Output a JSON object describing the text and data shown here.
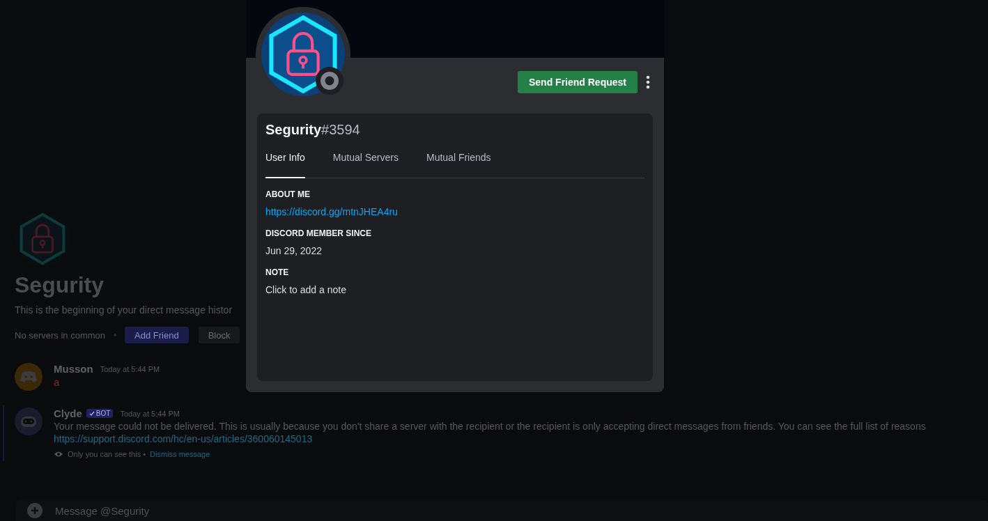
{
  "dm_header": {
    "name": "Segurity",
    "intro": "This is the beginning of your direct message histor",
    "mutual": "No servers in common",
    "buttons": [
      {
        "label": "Add Friend",
        "kind": "primary"
      },
      {
        "label": "Block",
        "kind": "secondary"
      }
    ]
  },
  "messages": [
    {
      "author": "Musson",
      "kind": "user",
      "time": "Today at 5:44 PM",
      "text": "a"
    },
    {
      "author": "Clyde",
      "kind": "bot",
      "badge": "BOT",
      "time": "Today at 5:44 PM",
      "text": "Your message could not be delivered. This is usually because you don't share a server with the recipient or the recipient is only accepting direct messages from friends. You can see the full list of reasons",
      "link": "https://support.discord.com/hc/en-us/articles/360060145013",
      "note": "Only you can see this •",
      "dismiss": "Dismiss message"
    }
  ],
  "composer": {
    "placeholder": "Message @Segurity"
  },
  "profile": {
    "username": "Segurity",
    "discriminator": "#3594",
    "action": "Send Friend Request",
    "tabs": [
      {
        "label": "User Info",
        "selected": true
      },
      {
        "label": "Mutual Servers",
        "selected": false
      },
      {
        "label": "Mutual Friends",
        "selected": false
      }
    ],
    "sections": [
      {
        "heading": "ABOUT ME",
        "kind": "link",
        "text": "https://discord.gg/mtnJHEA4ru"
      },
      {
        "heading": "DISCORD MEMBER SINCE",
        "kind": "text",
        "text": "Jun 29, 2022"
      },
      {
        "heading": "NOTE",
        "kind": "text",
        "text": "Click to add a note"
      }
    ]
  }
}
